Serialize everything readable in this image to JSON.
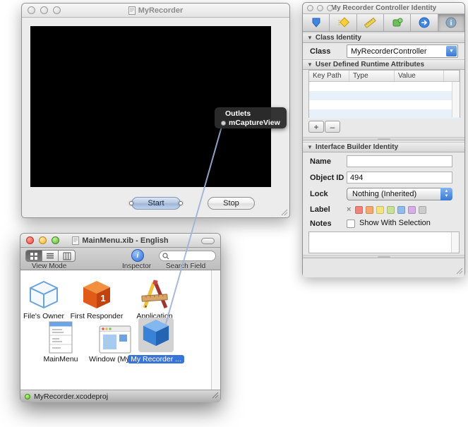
{
  "myrecorder": {
    "title": "MyRecorder",
    "start_label": "Start",
    "stop_label": "Stop",
    "hud": {
      "title": "Outlets",
      "outlet": "mCaptureView"
    }
  },
  "inspector": {
    "title": "My Recorder Controller Identity",
    "toolbar_tabs": [
      "attributes",
      "effects",
      "size",
      "bindings",
      "connections",
      "identity"
    ],
    "class_identity": {
      "header": "Class Identity",
      "class_label": "Class",
      "class_value": "MyRecorderController"
    },
    "runtime_attributes": {
      "header": "User Defined Runtime Attributes",
      "columns": [
        "Key Path",
        "Type",
        "Value"
      ],
      "add_label": "+",
      "remove_label": "–"
    },
    "ib_identity": {
      "header": "Interface Builder Identity",
      "name_label": "Name",
      "name_value": "",
      "object_id_label": "Object ID",
      "object_id_value": "494",
      "lock_label": "Lock",
      "lock_value": "Nothing (Inherited)",
      "label_label": "Label",
      "label_clear": "×",
      "label_colors": [
        "#f2837b",
        "#f6a96d",
        "#f4e47a",
        "#c7e292",
        "#8fbcf0",
        "#d4aee4",
        "#cccccc"
      ],
      "notes_label": "Notes",
      "notes_checkbox": "Show With Selection"
    }
  },
  "xib": {
    "title": "MainMenu.xib - English",
    "toolbar": {
      "view_mode_label": "View Mode",
      "inspector_label": "Inspector",
      "search_label": "Search Field",
      "search_value": ""
    },
    "items": [
      {
        "label": "File's Owner"
      },
      {
        "label": "First Responder"
      },
      {
        "label": "Application"
      },
      {
        "label": "MainMenu"
      },
      {
        "label": "Window (MyR..."
      },
      {
        "label": "My Recorder ..."
      }
    ],
    "status": "MyRecorder.xcodeproj"
  },
  "colors": {
    "selection_blue": "#3875d7",
    "connection_line": "#9db3d8",
    "hud_background": "#2c2c2c"
  }
}
